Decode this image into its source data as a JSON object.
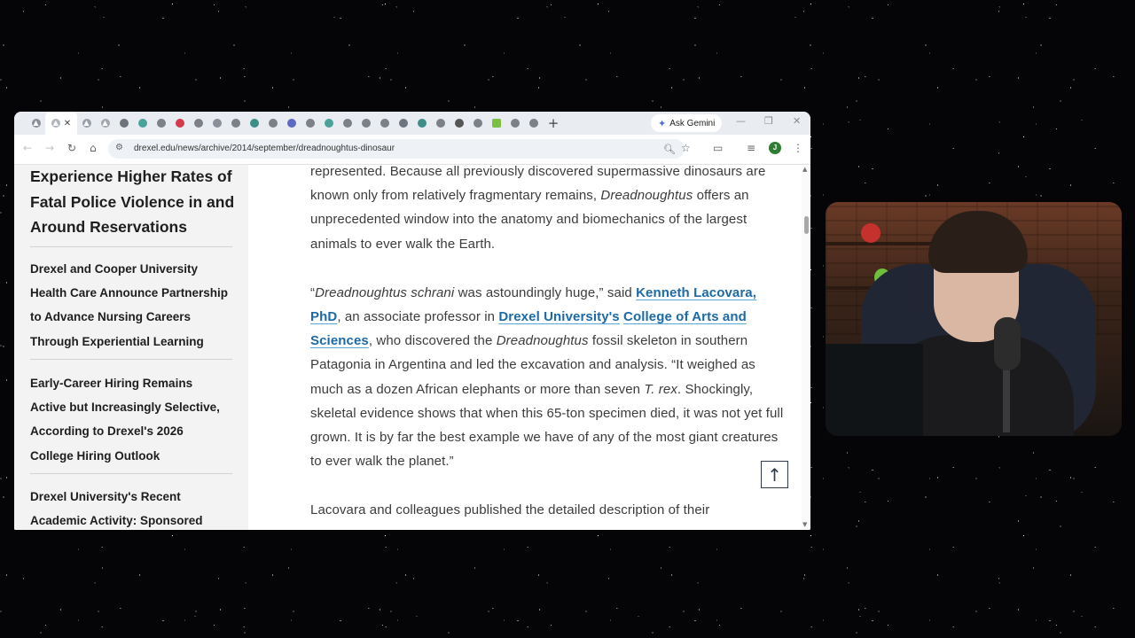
{
  "browser": {
    "active_tab": {
      "icon": "drexel-icon",
      "close": "✕"
    },
    "tab_icons": [
      "drexel-icon",
      "drexel-icon",
      "gear-icon",
      "globe-icon",
      "pocket-icon",
      "globe-icon",
      "drexel-icon",
      "globe-icon",
      "teal-icon",
      "globe-icon",
      "wordpress-icon",
      "globe-icon",
      "teal-icon",
      "globe-icon",
      "globe-icon",
      "globe-icon",
      "wordpress-icon",
      "teal-icon",
      "globe-icon",
      "copilot-icon",
      "globe-icon",
      "green-icon",
      "globe-icon",
      "globe-icon"
    ],
    "new_tab": "+",
    "ask_gemini": "Ask Gemini",
    "url": "drexel.edu/news/archive/2014/september/dreadnoughtus-dinosaur",
    "profile_initial": "J",
    "colors": {
      "accent_link": "#1c6aa7",
      "tab_strip": "#e9edf2"
    }
  },
  "sidebar": {
    "heading": [
      "Experience Higher Rates of",
      "Fatal Police Violence in and",
      "Around Reservations"
    ],
    "items": [
      {
        "lines": [
          "Drexel and Cooper University",
          "Health Care Announce Partnership",
          "to Advance Nursing Careers",
          "Through Experiential Learning"
        ]
      },
      {
        "lines": [
          "Early-Career Hiring Remains",
          "Active but Increasingly Selective,",
          "According to Drexel's 2026",
          "College Hiring Outlook"
        ]
      },
      {
        "lines": [
          "Drexel University's Recent",
          "Academic Activity: Sponsored"
        ]
      }
    ]
  },
  "article": {
    "p1": {
      "t1": "represented. Because all previously discovered supermassive dinosaurs are known only from relatively fragmentary remains, ",
      "em1": "Dreadnoughtus",
      "t2": " offers an unprecedented window into the anatomy and biomechanics of the largest animals to ever walk the Earth."
    },
    "p2": {
      "t1": "“",
      "em1": "Dreadnoughtus schrani",
      "t2": " was astoundingly huge,” said ",
      "link1": "Kenneth Lacovara, PhD",
      "t3": ", an associate professor in ",
      "link2": "Drexel University's",
      "t4": " ",
      "link3": "College of Arts and Sciences",
      "t5": ", who discovered the ",
      "em2": "Dreadnoughtus",
      "t6": " fossil skeleton in southern Patagonia in Argentina and led the excavation and analysis. “It weighed as much as a dozen African elephants or more than seven ",
      "em3": "T. rex",
      "t7": ". Shockingly, skeletal evidence shows that when this 65-ton specimen died, it was not yet full grown. It is by far the best example we have of any of the most giant creatures to ever walk the planet.”"
    },
    "p3": {
      "t1": "Lacovara and colleagues published the detailed description of their"
    },
    "scroll_top_icon": "↑"
  }
}
